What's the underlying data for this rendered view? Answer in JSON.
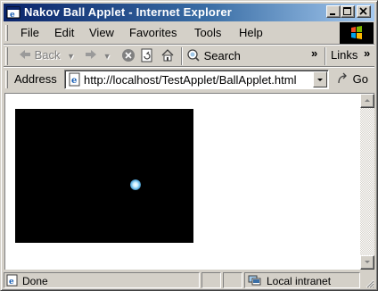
{
  "window": {
    "title": "Nakov Ball Applet - Internet Explorer"
  },
  "menu": [
    {
      "label": "File"
    },
    {
      "label": "Edit"
    },
    {
      "label": "View"
    },
    {
      "label": "Favorites"
    },
    {
      "label": "Tools"
    },
    {
      "label": "Help"
    }
  ],
  "toolbar": {
    "back_label": "Back",
    "search_label": "Search",
    "links_label": "Links",
    "chevron": "»"
  },
  "address": {
    "label": "Address",
    "url": "http://localhost/TestApplet/BallApplet.html",
    "go_label": "Go"
  },
  "status": {
    "text": "Done",
    "zone": "Local intranet"
  },
  "icons": {
    "title": "ie-icon",
    "back": "back-arrow-icon",
    "forward": "forward-arrow-icon",
    "stop": "stop-icon",
    "refresh": "refresh-icon",
    "home": "home-icon",
    "search": "search-icon",
    "page": "ie-page-icon",
    "go": "go-arrow-icon",
    "zone": "intranet-icon"
  }
}
